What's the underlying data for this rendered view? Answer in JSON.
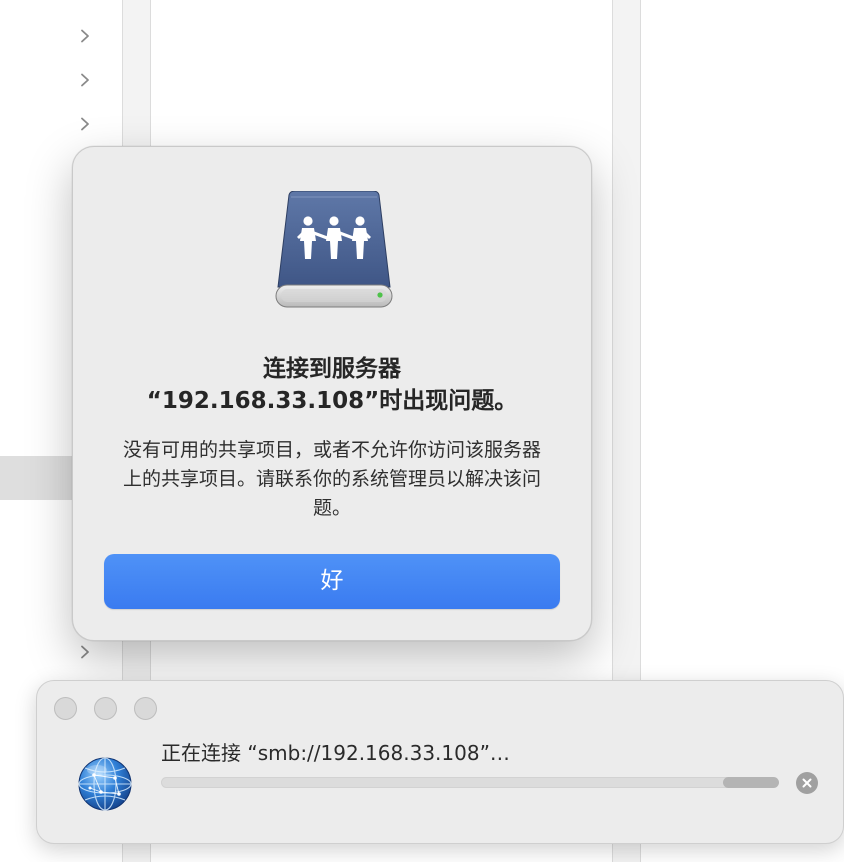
{
  "alert": {
    "title_line1": "连接到服务器",
    "title_line2": "“192.168.33.108”时出现问题。",
    "message": "没有可用的共享项目，或者不允许你访问该服务器上的共享项目。请联系你的系统管理员以解决该问题。",
    "ok_label": "好",
    "button_color": "#3B7CF1",
    "icon": "shared-server-icon"
  },
  "connection_window": {
    "status_text": "正在连接 “smb://192.168.33.108”…",
    "icon": "network-globe-icon",
    "progress_state": "indeterminate",
    "cancel_icon": "cancel-x-icon"
  },
  "finder_background": {
    "chevron_icon": "chevron-right-icon"
  }
}
